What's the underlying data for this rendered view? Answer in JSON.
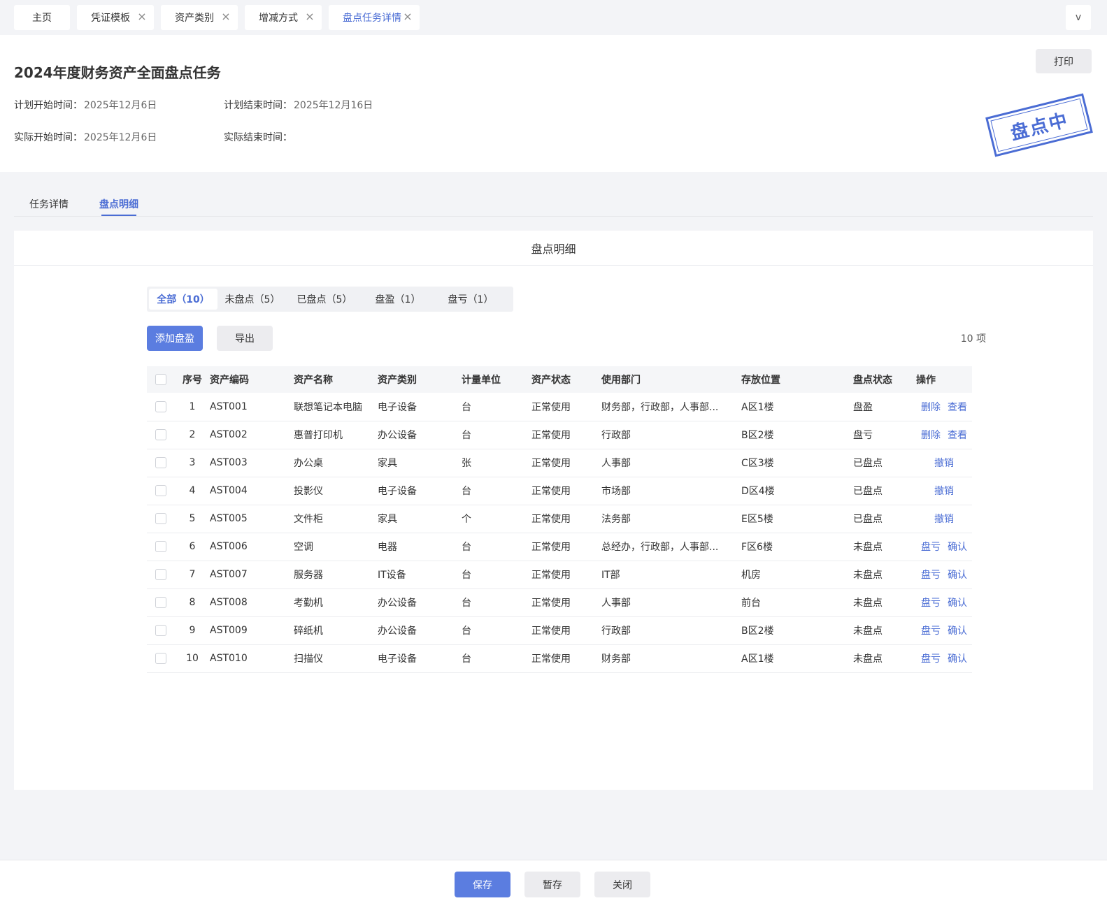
{
  "tabs": [
    {
      "label": "主页",
      "closable": false
    },
    {
      "label": "凭证模板",
      "closable": true
    },
    {
      "label": "资产类别",
      "closable": true
    },
    {
      "label": "增减方式",
      "closable": true
    },
    {
      "label": "盘点任务详情",
      "closable": true,
      "active": true
    }
  ],
  "tab_more_label": "v",
  "header": {
    "title": "2024年度财务资产全面盘点任务",
    "print_label": "打印",
    "plan_start_label": "计划开始时间：",
    "plan_start_value": "2025年12月6日",
    "plan_end_label": "计划结束时间：",
    "plan_end_value": "2025年12月16日",
    "actual_start_label": "实际开始时间：",
    "actual_start_value": "2025年12月6日",
    "actual_end_label": "实际结束时间：",
    "actual_end_value": "",
    "stamp": "盘点中"
  },
  "section_tabs": [
    "任务详情",
    "盘点明细"
  ],
  "panel": {
    "title": "盘点明细",
    "filters": [
      "全部（10）",
      "未盘点（5）",
      "已盘点（5）",
      "盘盈（1）",
      "盘亏（1）"
    ],
    "add_label": "添加盘盈",
    "export_label": "导出",
    "count_label": "10 项"
  },
  "table": {
    "headers": [
      "序号",
      "资产编码",
      "资产名称",
      "资产类别",
      "计量单位",
      "资产状态",
      "使用部门",
      "存放位置",
      "盘点状态",
      "操作"
    ],
    "rows": [
      {
        "idx": "1",
        "code": "AST001",
        "name": "联想笔记本电脑",
        "category": "电子设备",
        "unit": "台",
        "status": "正常使用",
        "dept": "财务部，行政部，人事部...",
        "location": "A区1楼",
        "check": "盘盈",
        "ops": [
          "删除",
          "查看"
        ]
      },
      {
        "idx": "2",
        "code": "AST002",
        "name": "惠普打印机",
        "category": "办公设备",
        "unit": "台",
        "status": "正常使用",
        "dept": "行政部",
        "location": "B区2楼",
        "check": "盘亏",
        "ops": [
          "删除",
          "查看"
        ]
      },
      {
        "idx": "3",
        "code": "AST003",
        "name": "办公桌",
        "category": "家具",
        "unit": "张",
        "status": "正常使用",
        "dept": "人事部",
        "location": "C区3楼",
        "check": "已盘点",
        "ops": [
          "撤销"
        ]
      },
      {
        "idx": "4",
        "code": "AST004",
        "name": "投影仪",
        "category": "电子设备",
        "unit": "台",
        "status": "正常使用",
        "dept": "市场部",
        "location": "D区4楼",
        "check": "已盘点",
        "ops": [
          "撤销"
        ]
      },
      {
        "idx": "5",
        "code": "AST005",
        "name": "文件柜",
        "category": "家具",
        "unit": "个",
        "status": "正常使用",
        "dept": "法务部",
        "location": "E区5楼",
        "check": "已盘点",
        "ops": [
          "撤销"
        ]
      },
      {
        "idx": "6",
        "code": "AST006",
        "name": "空调",
        "category": "电器",
        "unit": "台",
        "status": "正常使用",
        "dept": "总经办，行政部，人事部...",
        "location": "F区6楼",
        "check": "未盘点",
        "ops": [
          "盘亏",
          "确认"
        ]
      },
      {
        "idx": "7",
        "code": "AST007",
        "name": "服务器",
        "category": "IT设备",
        "unit": "台",
        "status": "正常使用",
        "dept": "IT部",
        "location": "机房",
        "check": "未盘点",
        "ops": [
          "盘亏",
          "确认"
        ]
      },
      {
        "idx": "8",
        "code": "AST008",
        "name": "考勤机",
        "category": "办公设备",
        "unit": "台",
        "status": "正常使用",
        "dept": "人事部",
        "location": "前台",
        "check": "未盘点",
        "ops": [
          "盘亏",
          "确认"
        ]
      },
      {
        "idx": "9",
        "code": "AST009",
        "name": "碎纸机",
        "category": "办公设备",
        "unit": "台",
        "status": "正常使用",
        "dept": "行政部",
        "location": "B区2楼",
        "check": "未盘点",
        "ops": [
          "盘亏",
          "确认"
        ]
      },
      {
        "idx": "10",
        "code": "AST010",
        "name": "扫描仪",
        "category": "电子设备",
        "unit": "台",
        "status": "正常使用",
        "dept": "财务部",
        "location": "A区1楼",
        "check": "未盘点",
        "ops": [
          "盘亏",
          "确认"
        ]
      }
    ]
  },
  "footer": {
    "save": "保存",
    "draft": "暂存",
    "close": "关闭"
  },
  "colors": {
    "accent": "#4a6cd4",
    "primary_button": "#5b7de0",
    "page_bg": "#f3f4f7"
  }
}
